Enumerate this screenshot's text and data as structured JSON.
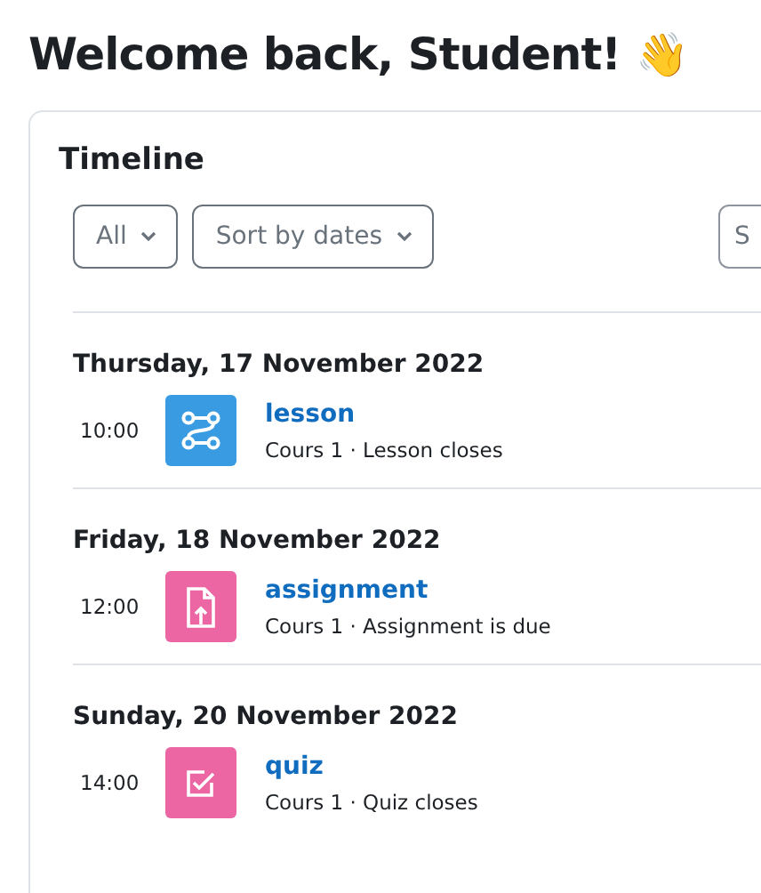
{
  "heading": "Welcome back, Student!",
  "heading_emoji": "👋",
  "timeline": {
    "title": "Timeline",
    "filters": [
      {
        "label": "All"
      },
      {
        "label": "Sort by dates"
      }
    ],
    "search": {
      "placeholder": "S"
    },
    "days": [
      {
        "date": "Thursday, 17 November 2022",
        "events": [
          {
            "time": "10:00",
            "kind": "lesson",
            "color": "#399be2",
            "title": "lesson",
            "detail": "Cours 1 · Lesson closes"
          }
        ]
      },
      {
        "date": "Friday, 18 November 2022",
        "events": [
          {
            "time": "12:00",
            "kind": "assignment",
            "color": "#eb66a2",
            "title": "assignment",
            "detail": "Cours 1 · Assignment is due"
          }
        ]
      },
      {
        "date": "Sunday, 20 November 2022",
        "events": [
          {
            "time": "14:00",
            "kind": "quiz",
            "color": "#eb66a2",
            "title": "quiz",
            "detail": "Cours 1 · Quiz closes"
          }
        ]
      }
    ]
  }
}
